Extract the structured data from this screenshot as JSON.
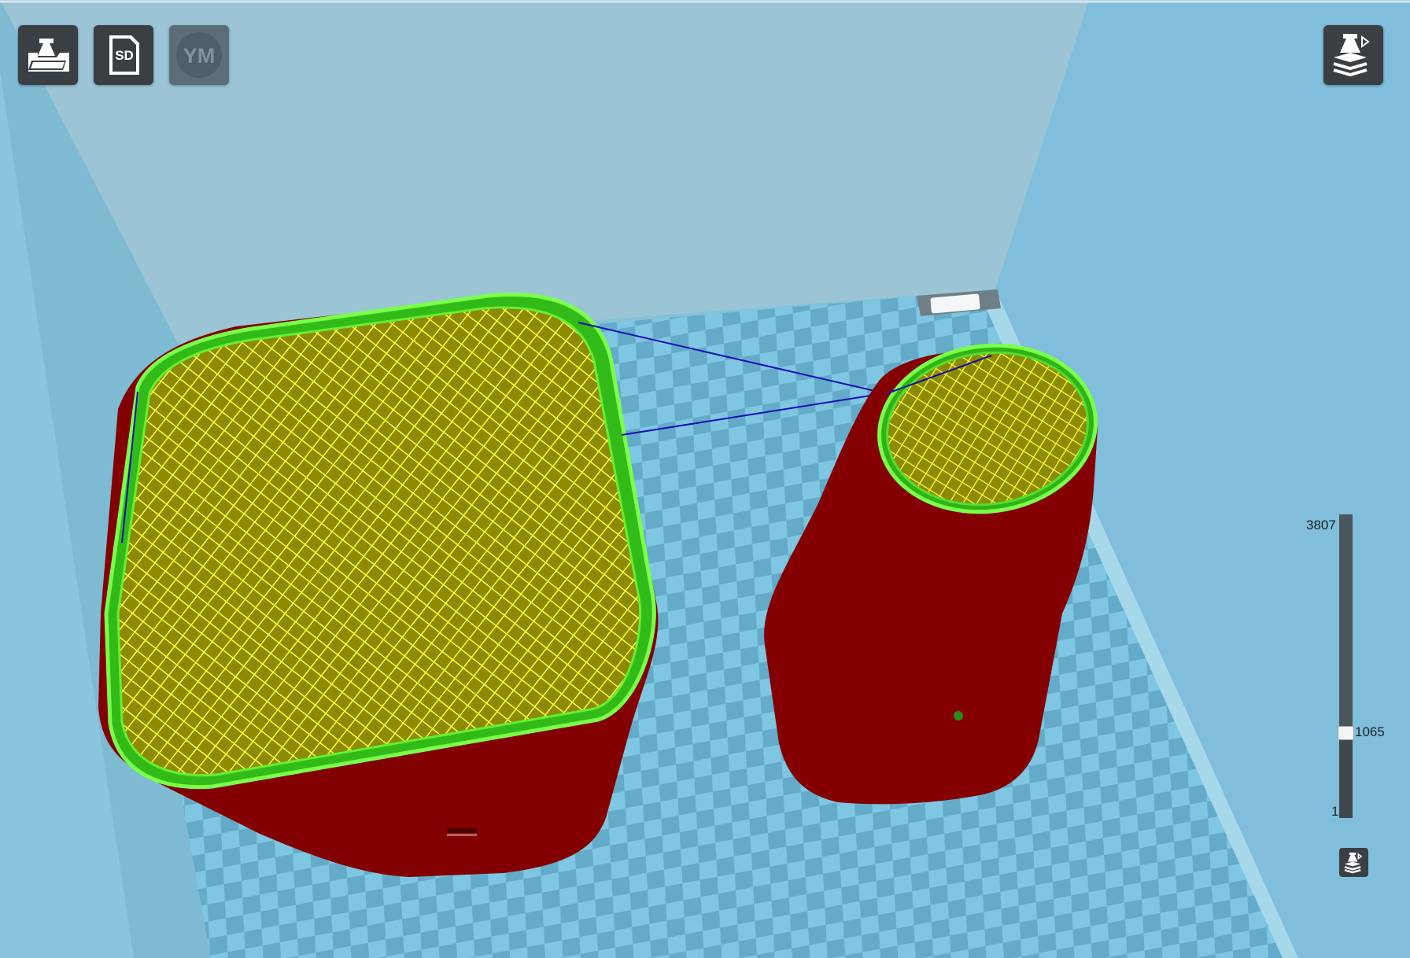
{
  "toolbar": {
    "load_icon": "printer-load-icon",
    "sd_icon": "sd-card-icon",
    "sd_label": "SD",
    "ym_icon": "youmagine-icon",
    "ym_label": "YM",
    "view_icon": "layer-view-icon"
  },
  "layer_slider": {
    "max": 3807,
    "min": 1,
    "current": 1065,
    "max_label": "3807",
    "min_label": "1",
    "current_label": "1065"
  },
  "view_mode_icon": "layer-view-small-icon",
  "colors": {
    "background": "#8ec6dc",
    "plate_light": "#7fc6e2",
    "plate_dark": "#5fa6c6",
    "object_shell": "#8b0000",
    "infill_fill": "#8c8a00",
    "infill_lines": "#ffff22",
    "outer_wall": "#44dd22",
    "travel": "#0000aa",
    "button_bg": "#3a3f44"
  }
}
